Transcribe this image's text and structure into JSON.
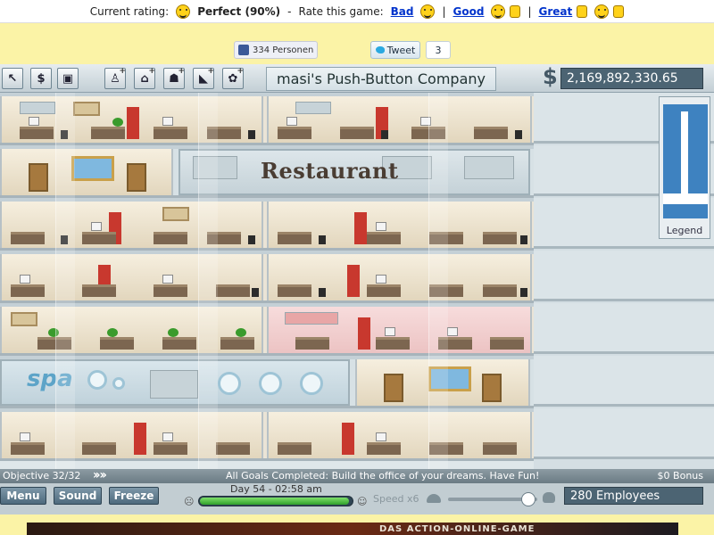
{
  "rating_bar": {
    "current_label": "Current rating:",
    "current_value": "Perfect (90%)",
    "separator": "-",
    "rate_label": "Rate this game:",
    "options": [
      "Bad",
      "Good",
      "Great"
    ],
    "divider": "|"
  },
  "social": {
    "like_text": "334 Personen",
    "tweet_label": "Tweet",
    "tweet_count": "3"
  },
  "toolbar": {
    "tools": [
      {
        "icon": "cursor-icon",
        "glyph": "↖"
      },
      {
        "icon": "dollar-icon",
        "glyph": "$"
      },
      {
        "icon": "building-icon",
        "glyph": "▣"
      },
      {
        "icon": "add-employee-icon",
        "glyph": "♙"
      },
      {
        "icon": "add-office-icon",
        "glyph": "⌂"
      },
      {
        "icon": "add-restroom-icon",
        "glyph": "☗"
      },
      {
        "icon": "add-stairs-icon",
        "glyph": "◣"
      },
      {
        "icon": "add-plant-icon",
        "glyph": "✿"
      }
    ],
    "company_name": "masi's Push-Button Company",
    "currency_symbol": "$",
    "money": "2,169,892,330.65"
  },
  "building": {
    "restaurant_label": "Restaurant",
    "spa_label": "spa"
  },
  "legend": {
    "label": "Legend"
  },
  "objective_bar": {
    "objective": "Objective 32/32",
    "goals": "All Goals Completed: Build the office of your dreams.  Have Fun!",
    "bonus": "$0 Bonus"
  },
  "controls": {
    "menu": "Menu",
    "sound": "Sound",
    "freeze": "Freeze",
    "day": "Day 54 - 02:58 am",
    "day_progress": 0.98,
    "speed": "Speed x6",
    "speed_level": 0.9,
    "employees": "280 Employees"
  },
  "ad": {
    "text": "DAS ACTION-ONLINE-GAME"
  },
  "colors": {
    "background": "#fbf3a6",
    "link": "#0033cc",
    "panel_dark": "#4c6473"
  }
}
